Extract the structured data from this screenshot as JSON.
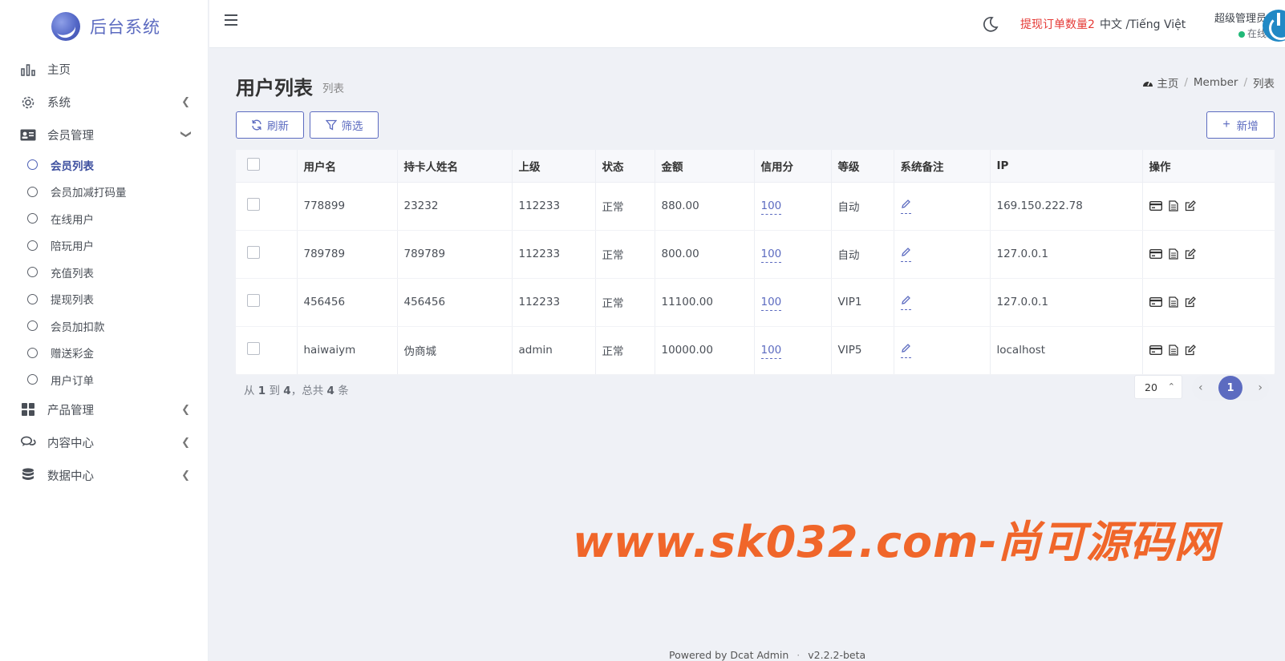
{
  "brand": {
    "name": "后台系统"
  },
  "sidebar": {
    "items": [
      {
        "label": "主页",
        "icon": "bar-chart-icon"
      },
      {
        "label": "系统",
        "icon": "gear-icon"
      },
      {
        "label": "会员管理",
        "icon": "id-card-icon"
      },
      {
        "label": "产品管理",
        "icon": "grid-icon"
      },
      {
        "label": "内容中心",
        "icon": "chat-icon"
      },
      {
        "label": "数据中心",
        "icon": "database-icon"
      }
    ],
    "member_sub": [
      {
        "label": "会员列表",
        "active": true
      },
      {
        "label": "会员加减打码量"
      },
      {
        "label": "在线用户"
      },
      {
        "label": "陪玩用户"
      },
      {
        "label": "充值列表"
      },
      {
        "label": "提现列表"
      },
      {
        "label": "会员加扣款"
      },
      {
        "label": "赠送彩金"
      },
      {
        "label": "用户订单"
      }
    ]
  },
  "navbar": {
    "alert": "提现订单数量2",
    "language": "中文 /Tiếng Việt",
    "user_name": "超级管理员",
    "user_status": "在线"
  },
  "page": {
    "title": "用户列表",
    "subtitle": "列表",
    "breadcrumb": [
      "主页",
      "Member",
      "列表"
    ]
  },
  "toolbar": {
    "refresh_label": "刷新",
    "filter_label": "筛选",
    "new_label": "新增"
  },
  "table": {
    "headers": [
      "用户名",
      "持卡人姓名",
      "上级",
      "状态",
      "金额",
      "信用分",
      "等级",
      "系统备注",
      "IP",
      "操作"
    ],
    "rows": [
      {
        "username": "778899",
        "cardholder": "23232",
        "parent": "112233",
        "status": "正常",
        "amount": "880.00",
        "credit": "100",
        "level": "自动",
        "ip": "169.150.222.78"
      },
      {
        "username": "789789",
        "cardholder": "789789",
        "parent": "112233",
        "status": "正常",
        "amount": "800.00",
        "credit": "100",
        "level": "自动",
        "ip": "127.0.0.1"
      },
      {
        "username": "456456",
        "cardholder": "456456",
        "parent": "112233",
        "status": "正常",
        "amount": "11100.00",
        "credit": "100",
        "level": "VIP1",
        "ip": "127.0.0.1"
      },
      {
        "username": "haiwaiym",
        "cardholder": "伪商城",
        "parent": "admin",
        "status": "正常",
        "amount": "10000.00",
        "credit": "100",
        "level": "VIP5",
        "ip": "localhost"
      }
    ]
  },
  "pagination": {
    "from_prefix": "从",
    "from": "1",
    "to_prefix": "到",
    "to": "4",
    "total_prefix": "，总共",
    "total": "4",
    "total_suffix": "条",
    "per_page": "20",
    "current_page": "1"
  },
  "watermark": "www.sk032.com-尚可源码网",
  "footer": {
    "powered": "Powered by Dcat Admin",
    "version": "v2.2.2-beta"
  },
  "colors": {
    "accent": "#5c6bc0",
    "alert": "#e53935",
    "watermark": "#f0662a",
    "online": "#21b978"
  }
}
